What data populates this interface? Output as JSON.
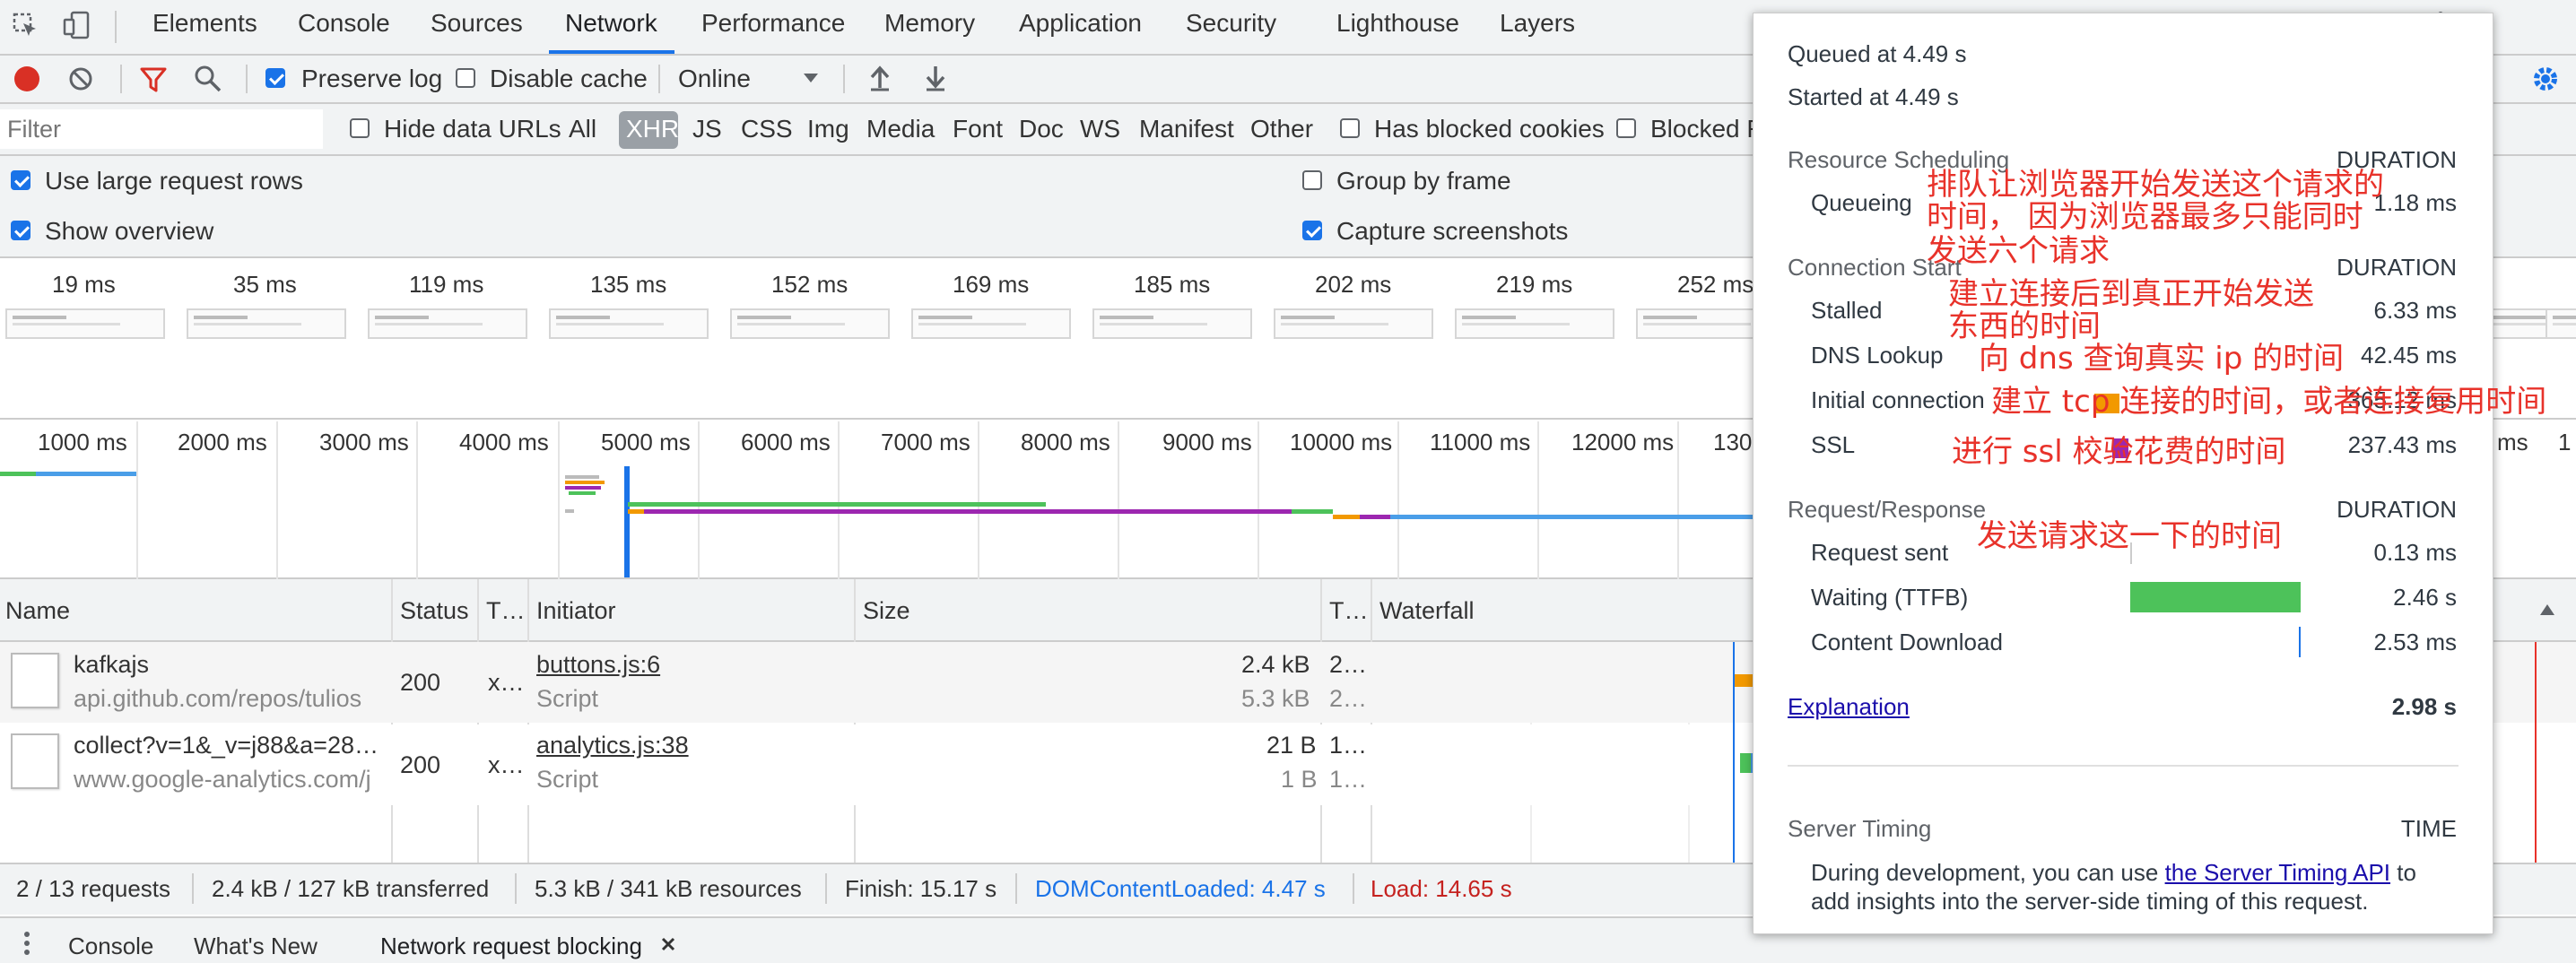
{
  "main_tabs": [
    "Elements",
    "Console",
    "Sources",
    "Network",
    "Performance",
    "Memory",
    "Application",
    "Security",
    "Lighthouse",
    "Layers"
  ],
  "toolbar": {
    "preserve_log": "Preserve log",
    "disable_cache": "Disable cache",
    "throttle": "Online"
  },
  "filter": {
    "placeholder": "Filter",
    "hide_data_urls": "Hide data URLs",
    "types": [
      "All",
      "XHR",
      "JS",
      "CSS",
      "Img",
      "Media",
      "Font",
      "Doc",
      "WS",
      "Manifest",
      "Other"
    ],
    "has_blocked_cookies": "Has blocked cookies",
    "blocked_requests": "Blocked R"
  },
  "settings": {
    "large_rows": "Use large request rows",
    "show_overview": "Show overview",
    "group_by_frame": "Group by frame",
    "capture_screenshots": "Capture screenshots"
  },
  "screenshots": [
    "19 ms",
    "35 ms",
    "119 ms",
    "135 ms",
    "152 ms",
    "169 ms",
    "185 ms",
    "202 ms",
    "219 ms",
    "252 ms"
  ],
  "overview_ticks": [
    "1000 ms",
    "2000 ms",
    "3000 ms",
    "4000 ms",
    "5000 ms",
    "6000 ms",
    "7000 ms",
    "8000 ms",
    "9000 ms",
    "10000 ms",
    "11000 ms",
    "12000 ms",
    "130"
  ],
  "overview_right": [
    "ms",
    "1"
  ],
  "table": {
    "headers": [
      "Name",
      "Status",
      "T…",
      "Initiator",
      "Size",
      "T…",
      "Waterfall"
    ],
    "rows": [
      {
        "name": "kafkajs",
        "domain": "api.github.com/repos/tulios",
        "status": "200",
        "type": "x…",
        "initiator": "buttons.js:6",
        "initiator_type": "Script",
        "size": "2.4 kB",
        "resource": "5.3 kB",
        "time": "2…",
        "time2": "2…"
      },
      {
        "name": "collect?v=1&_v=j88&a=28…",
        "domain": "www.google-analytics.com/j",
        "status": "200",
        "type": "x…",
        "initiator": "analytics.js:38",
        "initiator_type": "Script",
        "size": "21 B",
        "resource": "1 B",
        "time": "1…",
        "time2": "1…"
      }
    ]
  },
  "status_bar": {
    "requests": "2 / 13 requests",
    "transferred": "2.4 kB / 127 kB transferred",
    "resources": "5.3 kB / 341 kB resources",
    "finish": "Finish: 15.17 s",
    "dcl": "DOMContentLoaded: 4.47 s",
    "load": "Load: 14.65 s"
  },
  "drawer_tabs": [
    "Console",
    "What's New",
    "Network request blocking"
  ],
  "timing": {
    "queued": "Queued at 4.49 s",
    "started": "Started at 4.49 s",
    "duration_label": "DURATION",
    "resource_scheduling": "Resource Scheduling",
    "queueing": {
      "label": "Queueing",
      "value": "1.18 ms"
    },
    "connection_start": "Connection Start",
    "stalled": {
      "label": "Stalled",
      "value": "6.33 ms"
    },
    "dns": {
      "label": "DNS Lookup",
      "value": "42.45 ms"
    },
    "initial": {
      "label": "Initial connection",
      "value": "365.12 ms"
    },
    "ssl": {
      "label": "SSL",
      "value": "237.43 ms"
    },
    "request_response": "Request/Response",
    "sent": {
      "label": "Request sent",
      "value": "0.13 ms"
    },
    "waiting": {
      "label": "Waiting (TTFB)",
      "value": "2.46 s"
    },
    "download": {
      "label": "Content Download",
      "value": "2.53 ms"
    },
    "explanation": "Explanation",
    "total": "2.98 s",
    "server_timing": "Server Timing",
    "time_label": "TIME",
    "server_desc_1": "During development, you can use ",
    "server_link": "the Server Timing API",
    "server_desc_2": " to",
    "server_desc_3": "add insights into the server-side timing of this request."
  },
  "annotations": {
    "queueing_1": "排队让浏览器开始发送这个请求的",
    "queueing_2": "时间，  因为浏览器最多只能同时",
    "queueing_3": "发送六个请求",
    "stalled_1": "建立连接后到真正开始发送",
    "stalled_2": "东西的时间",
    "dns": "向 dns 查询真实 ip 的时间",
    "initial": "建立 tcp 连接的时间，或者连接复用时间",
    "ssl": "进行 ssl 校验花费的时间",
    "sent": "发送请求这一下的时间"
  },
  "colors": {
    "accent": "#1a73e8",
    "record": "#d93025",
    "waiting": "#4dc25a",
    "ssl": "#9c27b0",
    "initial": "#f29900"
  }
}
